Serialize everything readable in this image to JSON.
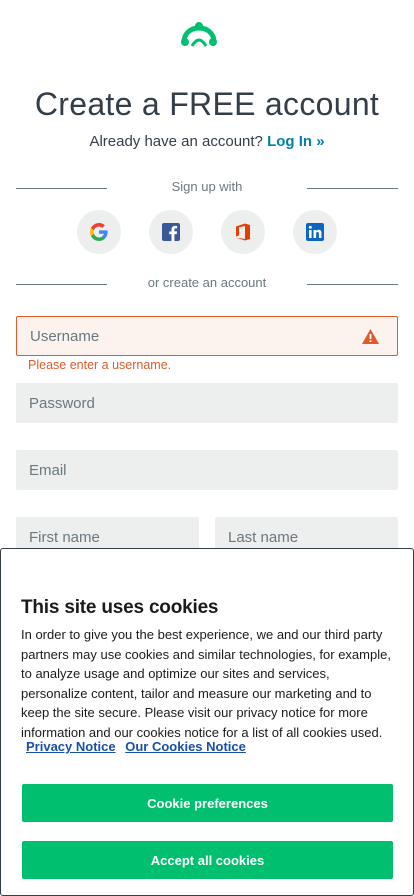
{
  "header": {
    "logo_icon": "surveymonkey-logo-icon",
    "title": "Create a FREE account",
    "already_text": "Already have an account?",
    "login_link": "Log In »"
  },
  "signup": {
    "divider_label": "Sign up with",
    "social_buttons": [
      {
        "name": "google",
        "icon": "google-icon"
      },
      {
        "name": "facebook",
        "icon": "facebook-icon"
      },
      {
        "name": "office",
        "icon": "office-icon"
      },
      {
        "name": "linkedin",
        "icon": "linkedin-icon"
      }
    ],
    "or_label": "or create an account"
  },
  "form": {
    "username_placeholder": "Username",
    "username_error": "Please enter a username.",
    "password_placeholder": "Password",
    "email_placeholder": "Email",
    "first_name_placeholder": "First name",
    "last_name_placeholder": "Last name"
  },
  "cookie_banner": {
    "title": "This site uses cookies",
    "body": "In order to give you the best experience, we and our third party partners may use cookies and similar technologies, for example, to analyze usage and optimize our sites and services, personalize content, tailor and measure our marketing and to keep the site secure. Please visit our privacy notice for more information and our cookies notice for a list of all cookies used.",
    "privacy_link": "Privacy Notice",
    "cookies_link": "Our Cookies Notice",
    "preferences_button": "Cookie preferences",
    "accept_button": "Accept all cookies"
  },
  "colors": {
    "brand_green": "#00bf6f",
    "link_blue": "#007faa",
    "error_orange": "#e05a2b"
  }
}
